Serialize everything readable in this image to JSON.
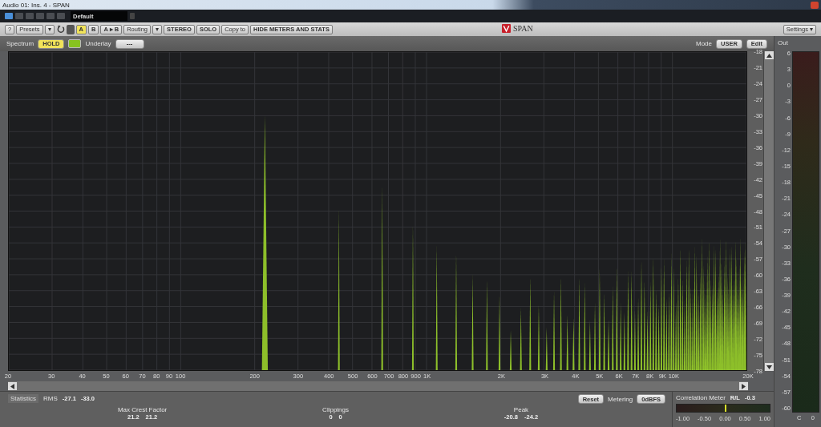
{
  "window": {
    "title": "Audio 01: Ins. 4 - SPAN"
  },
  "host_toolbar": {
    "preset": "Default"
  },
  "plugin_toolbar": {
    "help": "?",
    "presets": "Presets",
    "presets_menu": "▾",
    "ab": [
      {
        "label": "A",
        "selected": true
      },
      {
        "label": "B",
        "selected": false
      }
    ],
    "copy_ab": "A ▸ B",
    "routing": "Routing",
    "routing_menu": "▾",
    "buttons": [
      "STEREO",
      "SOLO",
      "Copy to",
      "HIDE METERS AND STATS"
    ],
    "logo": "SPAN",
    "settings": "Settings ▾"
  },
  "spectrum_header": {
    "title": "Spectrum",
    "hold": {
      "label": "HOLD",
      "on": true
    },
    "underlay_label": "Underlay",
    "underlay": "---",
    "mode_label": "Mode",
    "mode": "USER",
    "edit": "Edit"
  },
  "x_ticks": [
    "20",
    "30",
    "40",
    "50",
    "60",
    "70",
    "80",
    "90",
    "100",
    "200",
    "300",
    "400",
    "500",
    "600",
    "700",
    "800",
    "900",
    "1K",
    "2K",
    "3K",
    "4K",
    "5K",
    "6K",
    "7K",
    "8K",
    "9K",
    "10K",
    "20K"
  ],
  "y_ticks": [
    "-18",
    "-21",
    "-24",
    "-27",
    "-30",
    "-33",
    "-36",
    "-39",
    "-42",
    "-45",
    "-48",
    "-51",
    "-54",
    "-57",
    "-60",
    "-63",
    "-66",
    "-69",
    "-72",
    "-75",
    "-78"
  ],
  "statistics": {
    "title": "Statistics",
    "rms_label": "RMS",
    "rms": [
      "-27.1",
      "-33.0"
    ],
    "groups": [
      {
        "label": "Max Crest Factor",
        "values": [
          "21.2",
          "21.2"
        ]
      },
      {
        "label": "Clippings",
        "values": [
          "0",
          "0"
        ]
      },
      {
        "label": "Peak",
        "values": [
          "-20.8",
          "-24.2"
        ]
      }
    ],
    "reset": "Reset",
    "metering_label": "Metering",
    "metering": "0dBFS"
  },
  "correlation": {
    "title": "Correlation Meter",
    "channel": "R/L",
    "value": "-0.3",
    "level": 0.52,
    "scale": [
      "-1.00",
      "-0.50",
      "0.00",
      "0.50",
      "1.00"
    ]
  },
  "out_meter": {
    "title": "Out",
    "scale": [
      "6",
      "3",
      "0",
      "-3",
      "-6",
      "-9",
      "-12",
      "-15",
      "-18",
      "-21",
      "-24",
      "-27",
      "-30",
      "-33",
      "-36",
      "-39",
      "-42",
      "-45",
      "-48",
      "-51",
      "-54",
      "-57",
      "-60"
    ],
    "channels": [
      "C",
      "0"
    ]
  }
}
